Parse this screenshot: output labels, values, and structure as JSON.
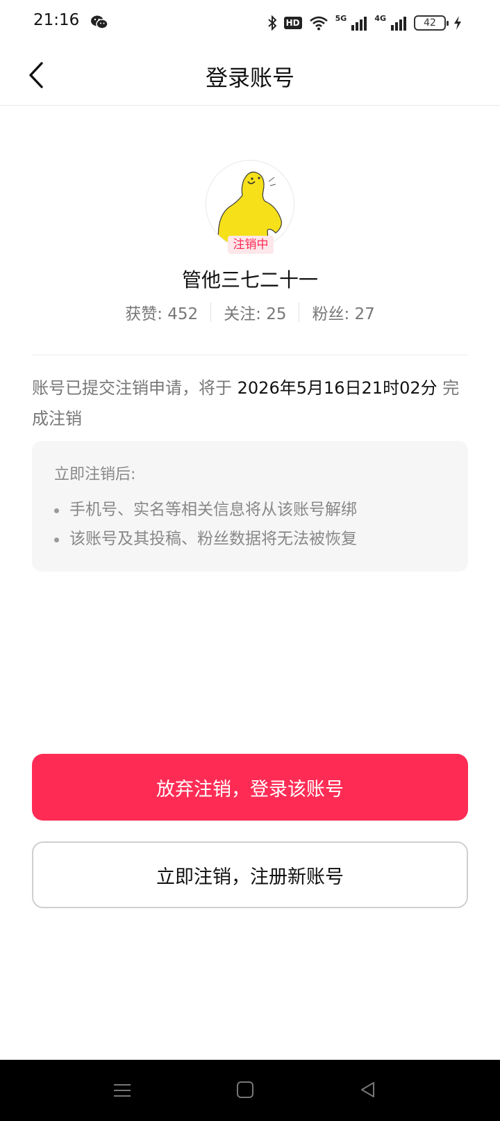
{
  "status_bar": {
    "time": "21:16",
    "battery": "42",
    "hd_label": "HD",
    "net1": "5G",
    "net2": "4G",
    "icons": [
      "wechat-icon",
      "bluetooth-icon",
      "wifi-icon",
      "signal-icon",
      "charging-icon"
    ]
  },
  "header": {
    "title": "登录账号",
    "back_icon": "chevron-left-icon"
  },
  "profile": {
    "status_tag": "注销中",
    "nickname": "管他三七二十一",
    "stats": [
      {
        "label": "获赞: 452"
      },
      {
        "label": "关注: 25"
      },
      {
        "label": "粉丝: 27"
      }
    ],
    "avatar_color": "#f5e01a"
  },
  "notice": {
    "prefix": "账号已提交注销申请，将于 ",
    "date": "2026年5月16日21时02分",
    "suffix": " 完成注销"
  },
  "info_box": {
    "title": "立即注销后:",
    "items": [
      "手机号、实名等相关信息将从该账号解绑",
      "该账号及其投稿、粉丝数据将无法被恢复"
    ]
  },
  "buttons": {
    "primary": "放弃注销，登录该账号",
    "secondary": "立即注销，注册新账号"
  },
  "colors": {
    "accent": "#fe2c55",
    "nav_bar": "#000000"
  }
}
